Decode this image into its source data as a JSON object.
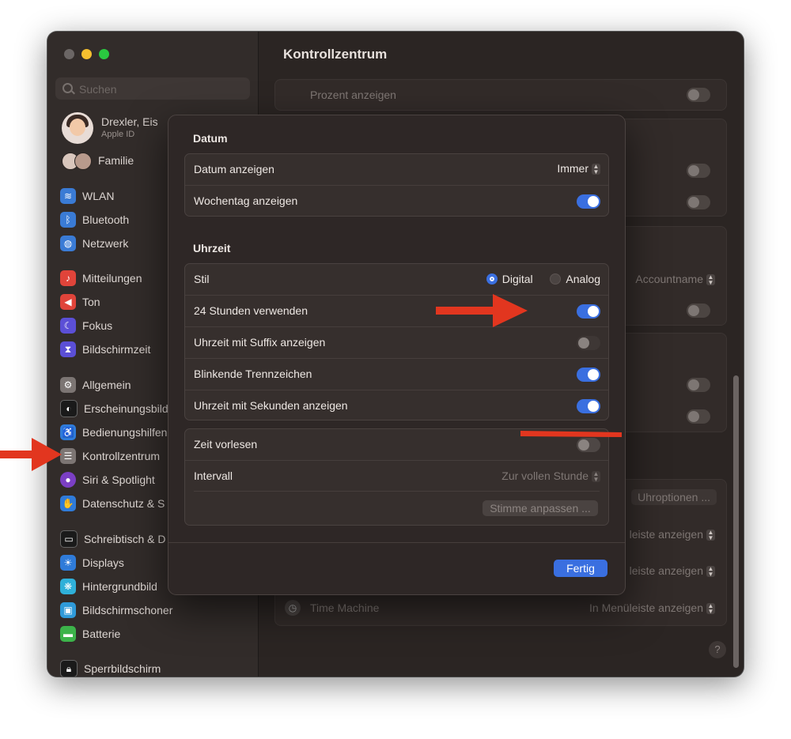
{
  "window": {
    "title": "Kontrollzentrum"
  },
  "sidebar": {
    "search_placeholder": "Suchen",
    "profile": {
      "name": "Drexler, Eis",
      "sub": "Apple ID"
    },
    "family": "Familie",
    "items": [
      {
        "label": "WLAN",
        "icon": "wifi-icon",
        "color": "#3a7bd5"
      },
      {
        "label": "Bluetooth",
        "icon": "bluetooth-icon",
        "color": "#3a7bd5"
      },
      {
        "label": "Netzwerk",
        "icon": "globe-icon",
        "color": "#3a7bd5"
      },
      {
        "label": "Mitteilungen",
        "icon": "bell-icon",
        "color": "#e0443a"
      },
      {
        "label": "Ton",
        "icon": "speaker-icon",
        "color": "#e0443a"
      },
      {
        "label": "Fokus",
        "icon": "moon-icon",
        "color": "#5b4fd6"
      },
      {
        "label": "Bildschirmzeit",
        "icon": "hourglass-icon",
        "color": "#5b4fd6"
      },
      {
        "label": "Allgemein",
        "icon": "gear-icon",
        "color": "#7c7573"
      },
      {
        "label": "Erscheinungsbild",
        "icon": "appearance-icon",
        "color": "#222"
      },
      {
        "label": "Bedienungshilfen",
        "icon": "accessibility-icon",
        "color": "#2f7bd9"
      },
      {
        "label": "Kontrollzentrum",
        "icon": "control-center-icon",
        "color": "#7c7573"
      },
      {
        "label": "Siri & Spotlight",
        "icon": "siri-icon",
        "color": "#7b3fc4"
      },
      {
        "label": "Datenschutz & S",
        "icon": "hand-icon",
        "color": "#2f7bd9"
      },
      {
        "label": "Schreibtisch & D",
        "icon": "desktop-icon",
        "color": "#222"
      },
      {
        "label": "Displays",
        "icon": "display-icon",
        "color": "#2f7bd9"
      },
      {
        "label": "Hintergrundbild",
        "icon": "wallpaper-icon",
        "color": "#2fb0d9"
      },
      {
        "label": "Bildschirmschoner",
        "icon": "screensaver-icon",
        "color": "#2f9ad9"
      },
      {
        "label": "Batterie",
        "icon": "battery-icon",
        "color": "#3cb34a"
      },
      {
        "label": "Sperrbildschirm",
        "icon": "lock-icon",
        "color": "#222"
      }
    ]
  },
  "main": {
    "rows": {
      "percent": "Prozent anzeigen",
      "account_select": "Accountname",
      "clock_options": "Uhroptionen ...",
      "menu_bar_1": "leiste anzeigen",
      "menu_bar_2": "leiste anzeigen",
      "time_machine": "Time Machine",
      "time_machine_select": "In Menüleiste anzeigen"
    },
    "help": "?"
  },
  "dialog": {
    "date_section": "Datum",
    "show_date": "Datum anzeigen",
    "show_date_value": "Immer",
    "show_weekday": "Wochentag anzeigen",
    "time_section": "Uhrzeit",
    "style": "Stil",
    "style_digital": "Digital",
    "style_analog": "Analog",
    "use_24h": "24 Stunden verwenden",
    "suffix": "Uhrzeit mit Suffix anzeigen",
    "blink": "Blinkende Trennzeichen",
    "seconds": "Uhrzeit mit Sekunden anzeigen",
    "announce": "Zeit vorlesen",
    "interval": "Intervall",
    "interval_value": "Zur vollen Stunde",
    "customize_voice": "Stimme anpassen ...",
    "done": "Fertig"
  },
  "colors": {
    "accent": "#3a6fe0",
    "arrow": "#e2361f"
  }
}
